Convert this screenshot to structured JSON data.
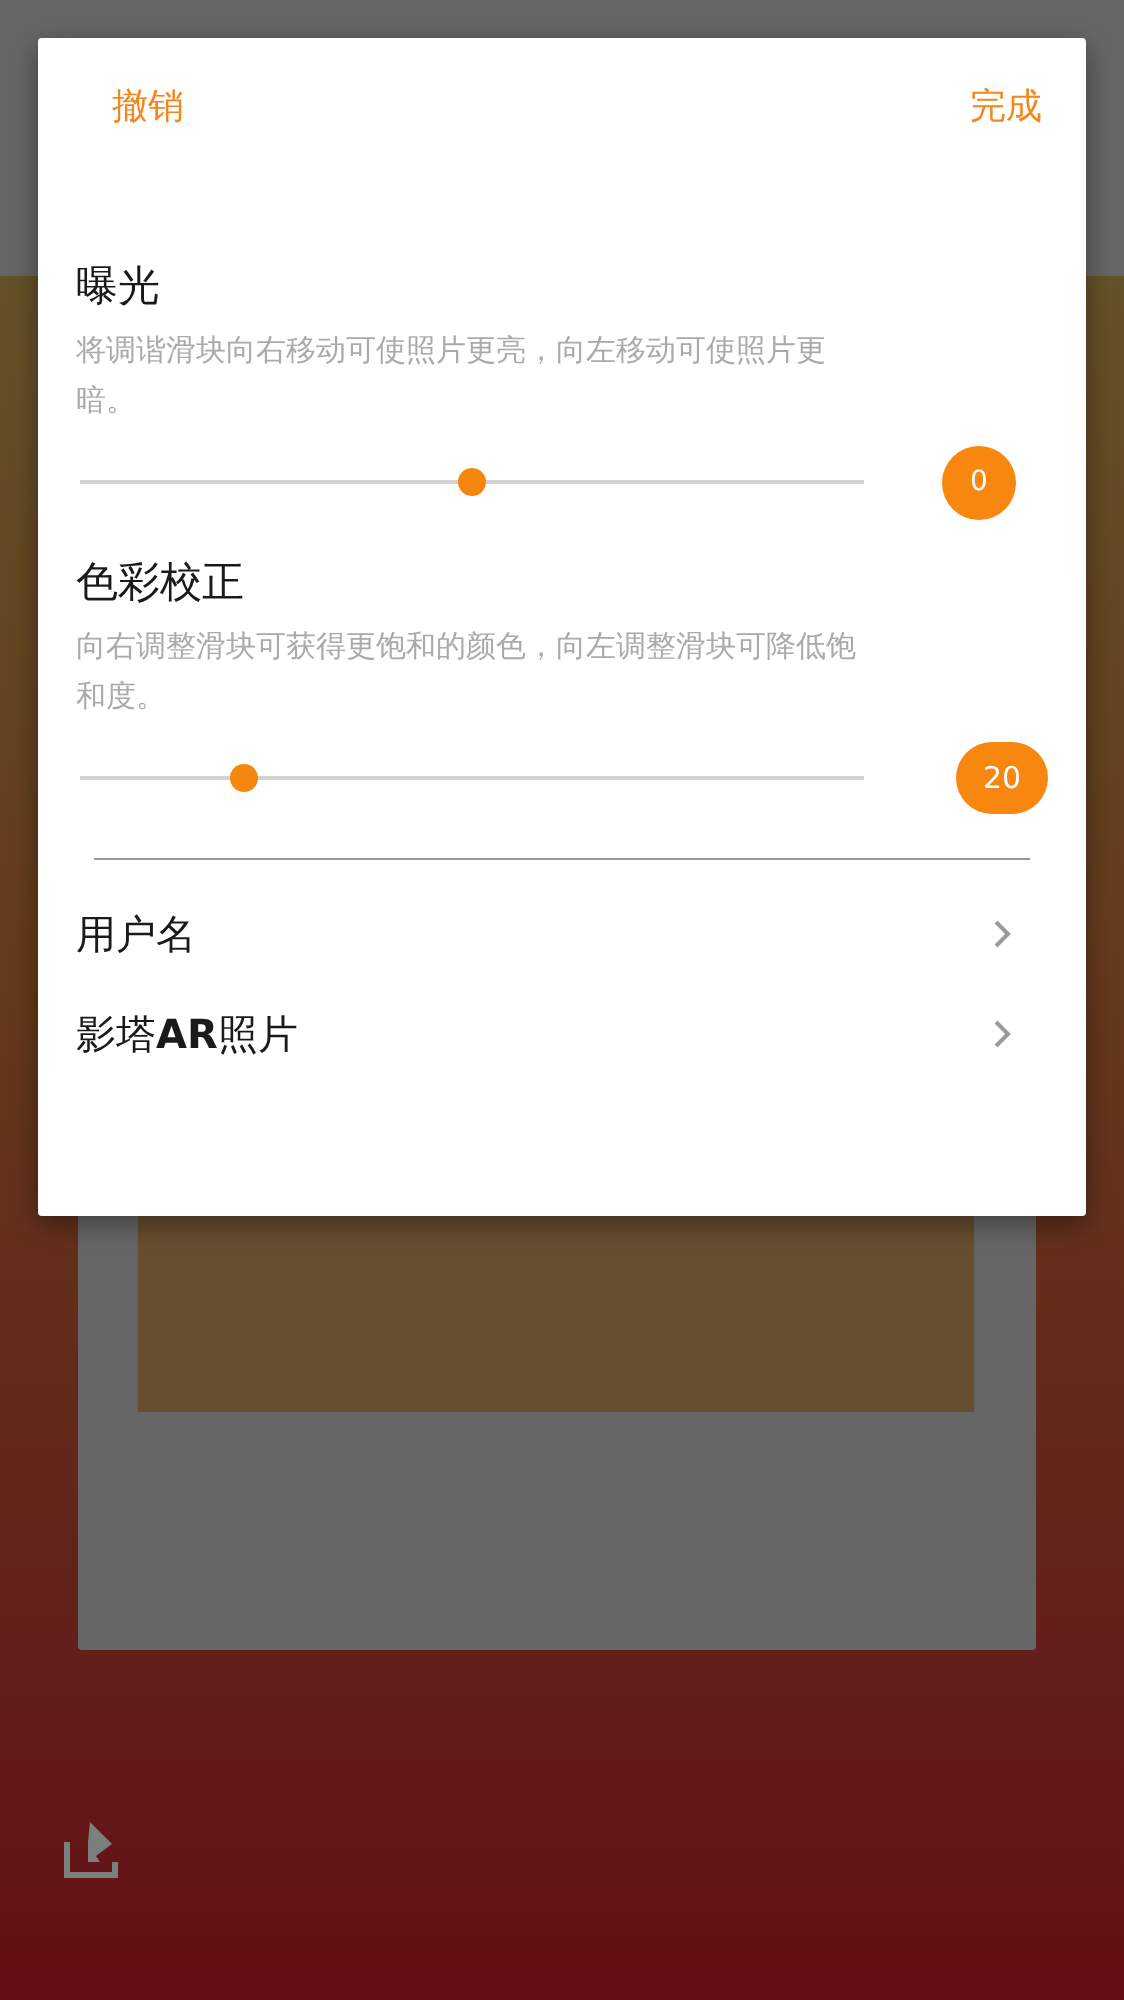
{
  "dialog": {
    "cancel": "撤销",
    "done": "完成",
    "adjustments": [
      {
        "title": "曝光",
        "description": "将调谐滑块向右移动可使照片更亮，向左移动可使照片更暗。",
        "level": 0.5,
        "value": "0"
      },
      {
        "title": "色彩校正",
        "description": "向右调整滑块可获得更饱和的颜色，向左调整滑块可降低饱和度。",
        "level": 0.21,
        "value": "20"
      }
    ],
    "links": [
      {
        "label": "用户名"
      },
      {
        "label": "影塔**AR**照片"
      }
    ]
  }
}
